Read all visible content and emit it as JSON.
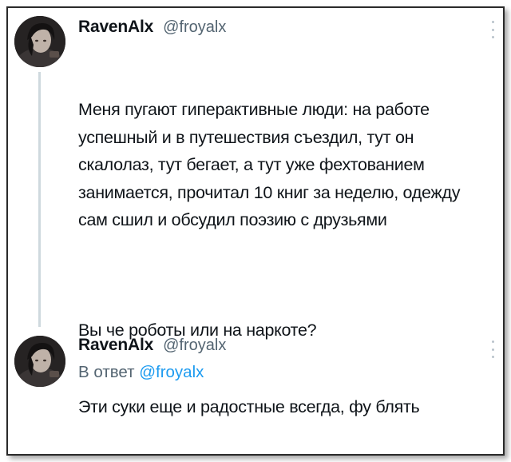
{
  "tweets": [
    {
      "author": {
        "name": "RavenAlx",
        "handle": "@froyalx"
      },
      "paragraphs": [
        "Меня пугают гиперактивные люди: на работе успешный и в путешествия съездил, тут он скалолаз, тут бегает, а тут уже фехтованием занимается, прочитал 10 книг за неделю, одежду сам сшил и обсудил поэзию с друзьями",
        "Вы че роботы или на наркоте?"
      ]
    },
    {
      "author": {
        "name": "RavenAlx",
        "handle": "@froyalx"
      },
      "reply_prefix": "В ответ",
      "reply_mention": "@froyalx",
      "text": "Эти суки еще и радостные всегда, фу блять"
    }
  ],
  "icons": {
    "more": "more-vertical-icon",
    "avatar": "avatar-image"
  },
  "colors": {
    "text": "#0f1419",
    "secondary": "#536471",
    "accent": "#1d9bf0",
    "thread_line": "#cfd9de"
  }
}
